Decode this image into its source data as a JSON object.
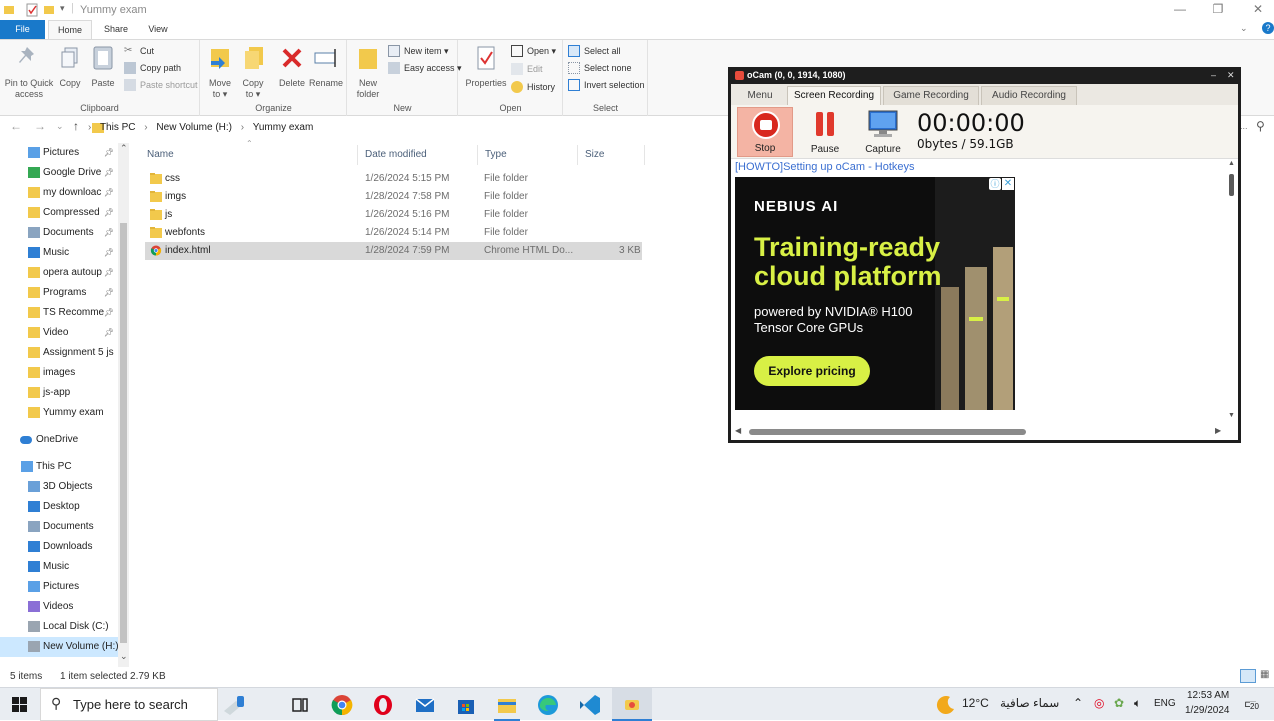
{
  "window": {
    "title": "Yummy exam"
  },
  "ribbon": {
    "tabs": {
      "file": "File",
      "home": "Home",
      "share": "Share",
      "view": "View"
    },
    "clipboard": {
      "label": "Clipboard",
      "pin_line1": "Pin to Quick",
      "pin_line2": "access",
      "copy": "Copy",
      "paste": "Paste",
      "cut": "Cut",
      "copy_path": "Copy path",
      "paste_shortcut": "Paste shortcut"
    },
    "organize": {
      "label": "Organize",
      "move_line1": "Move",
      "move_line2": "to ▾",
      "copy_line1": "Copy",
      "copy_line2": "to ▾",
      "delete": "Delete",
      "rename": "Rename"
    },
    "new": {
      "label": "New",
      "folder_line1": "New",
      "folder_line2": "folder",
      "new_item": "New item ▾",
      "easy_access": "Easy access ▾"
    },
    "open": {
      "label": "Open",
      "properties": "Properties",
      "open": "Open ▾",
      "edit": "Edit",
      "history": "History"
    },
    "select": {
      "label": "Select",
      "select_all": "Select all",
      "select_none": "Select none",
      "invert": "Invert selection"
    }
  },
  "breadcrumb": [
    "This PC",
    "New Volume (H:)",
    "Yummy exam"
  ],
  "nav": {
    "quick_access": [
      {
        "label": "Pictures",
        "icon": "pictures-icon",
        "pinned": true
      },
      {
        "label": "Google Drive",
        "icon": "google-drive-icon",
        "pinned": true
      },
      {
        "label": "my downloac",
        "icon": "folder-icon",
        "pinned": true
      },
      {
        "label": "Compressed",
        "icon": "folder-icon",
        "pinned": true
      },
      {
        "label": "Documents",
        "icon": "documents-icon",
        "pinned": true
      },
      {
        "label": "Music",
        "icon": "music-icon",
        "pinned": true
      },
      {
        "label": "opera autoup",
        "icon": "folder-icon",
        "pinned": true
      },
      {
        "label": "Programs",
        "icon": "folder-icon",
        "pinned": true
      },
      {
        "label": "TS Recomme",
        "icon": "folder-icon",
        "pinned": true
      },
      {
        "label": "Video",
        "icon": "folder-icon",
        "pinned": true
      },
      {
        "label": "Assignment 5 js",
        "icon": "folder-icon",
        "pinned": false
      },
      {
        "label": "images",
        "icon": "folder-icon",
        "pinned": false
      },
      {
        "label": "js-app",
        "icon": "folder-icon",
        "pinned": false
      },
      {
        "label": "Yummy exam",
        "icon": "folder-icon",
        "pinned": false
      }
    ],
    "onedrive": "OneDrive",
    "this_pc": "This PC",
    "pc_items": [
      {
        "label": "3D Objects",
        "icon": "3d-objects-icon"
      },
      {
        "label": "Desktop",
        "icon": "desktop-icon"
      },
      {
        "label": "Documents",
        "icon": "documents-icon"
      },
      {
        "label": "Downloads",
        "icon": "downloads-icon"
      },
      {
        "label": "Music",
        "icon": "music-icon"
      },
      {
        "label": "Pictures",
        "icon": "pictures-icon"
      },
      {
        "label": "Videos",
        "icon": "videos-icon"
      },
      {
        "label": "Local Disk (C:)",
        "icon": "drive-icon"
      },
      {
        "label": "New Volume (H:)",
        "icon": "drive-icon"
      }
    ]
  },
  "files": {
    "columns": {
      "name": "Name",
      "date": "Date modified",
      "type": "Type",
      "size": "Size"
    },
    "rows": [
      {
        "name": "css",
        "date": "1/26/2024 5:15 PM",
        "type": "File folder",
        "size": "",
        "kind": "folder"
      },
      {
        "name": "imgs",
        "date": "1/28/2024 7:58 PM",
        "type": "File folder",
        "size": "",
        "kind": "folder"
      },
      {
        "name": "js",
        "date": "1/26/2024 5:16 PM",
        "type": "File folder",
        "size": "",
        "kind": "folder"
      },
      {
        "name": "webfonts",
        "date": "1/26/2024 5:14 PM",
        "type": "File folder",
        "size": "",
        "kind": "folder"
      },
      {
        "name": "index.html",
        "date": "1/28/2024 7:59 PM",
        "type": "Chrome HTML Do...",
        "size": "3 KB",
        "kind": "chrome"
      }
    ]
  },
  "status": {
    "count": "5 items",
    "selection": "1 item selected  2.79 KB"
  },
  "ocam": {
    "title": "oCam (0, 0, 1914, 1080)",
    "tabs": [
      "Menu",
      "Screen Recording",
      "Game Recording",
      "Audio Recording"
    ],
    "tools": {
      "stop": "Stop",
      "pause": "Pause",
      "capture": "Capture"
    },
    "timer": "00:00:00",
    "storage": "0bytes / 59.1GB",
    "howto_link": "[HOWTO]Setting up oCam - Hotkeys",
    "ad": {
      "brand": "NEBIUS AI",
      "headline": "Training-ready cloud platform",
      "sub": "powered by NVIDIA® H100 Tensor Core GPUs",
      "cta": "Explore pricing"
    }
  },
  "taskbar": {
    "search_placeholder": "Type here to search",
    "weather_temp": "12°C",
    "weather_text": "سماء صافية",
    "lang": "ENG",
    "time": "12:53 AM",
    "date": "1/29/2024",
    "notif_count": "20"
  }
}
